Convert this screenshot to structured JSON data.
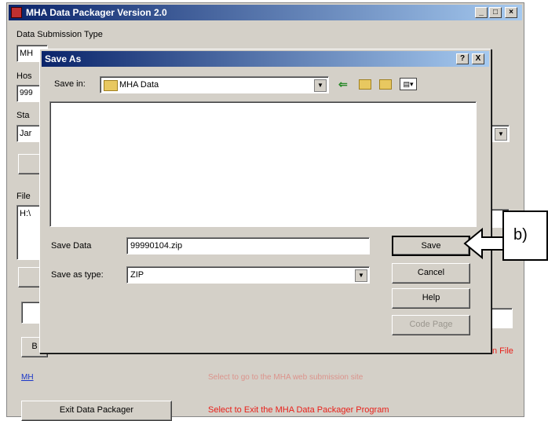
{
  "main_window": {
    "title": "MHA Data Packager Version 2.0",
    "data_submission_type_label": "Data Submission Type",
    "field_fragments": [
      "MH",
      "Hos",
      "999",
      "Sta",
      "Jar",
      "File",
      "H:\\"
    ],
    "b_button_fragment": "B",
    "link_fragment": "MH",
    "right_text_fragment": "n File",
    "exit_button": "Exit Data Packager",
    "exit_hint": "Select to Exit the MHA Data Packager Program",
    "link_hint_fragment": "Select to go to the MHA web submission site"
  },
  "dialog": {
    "title": "Save As",
    "help_btn": "?",
    "close_btn": "X",
    "save_in_label": "Save in:",
    "save_in_value": "MHA Data",
    "save_data_label": "Save Data",
    "save_data_value": "99990104.zip",
    "save_type_label": "Save as type:",
    "save_type_value": "ZIP",
    "buttons": {
      "save": "Save",
      "cancel": "Cancel",
      "help": "Help",
      "code_page": "Code Page"
    }
  },
  "callout": {
    "label": "b)"
  },
  "colors": {
    "title_bar": "#0a246a",
    "title_bar_end": "#a6caf0",
    "window_bg": "#d4d0c8",
    "hint_red": "#e8201a",
    "link_blue": "#1a36c8"
  }
}
